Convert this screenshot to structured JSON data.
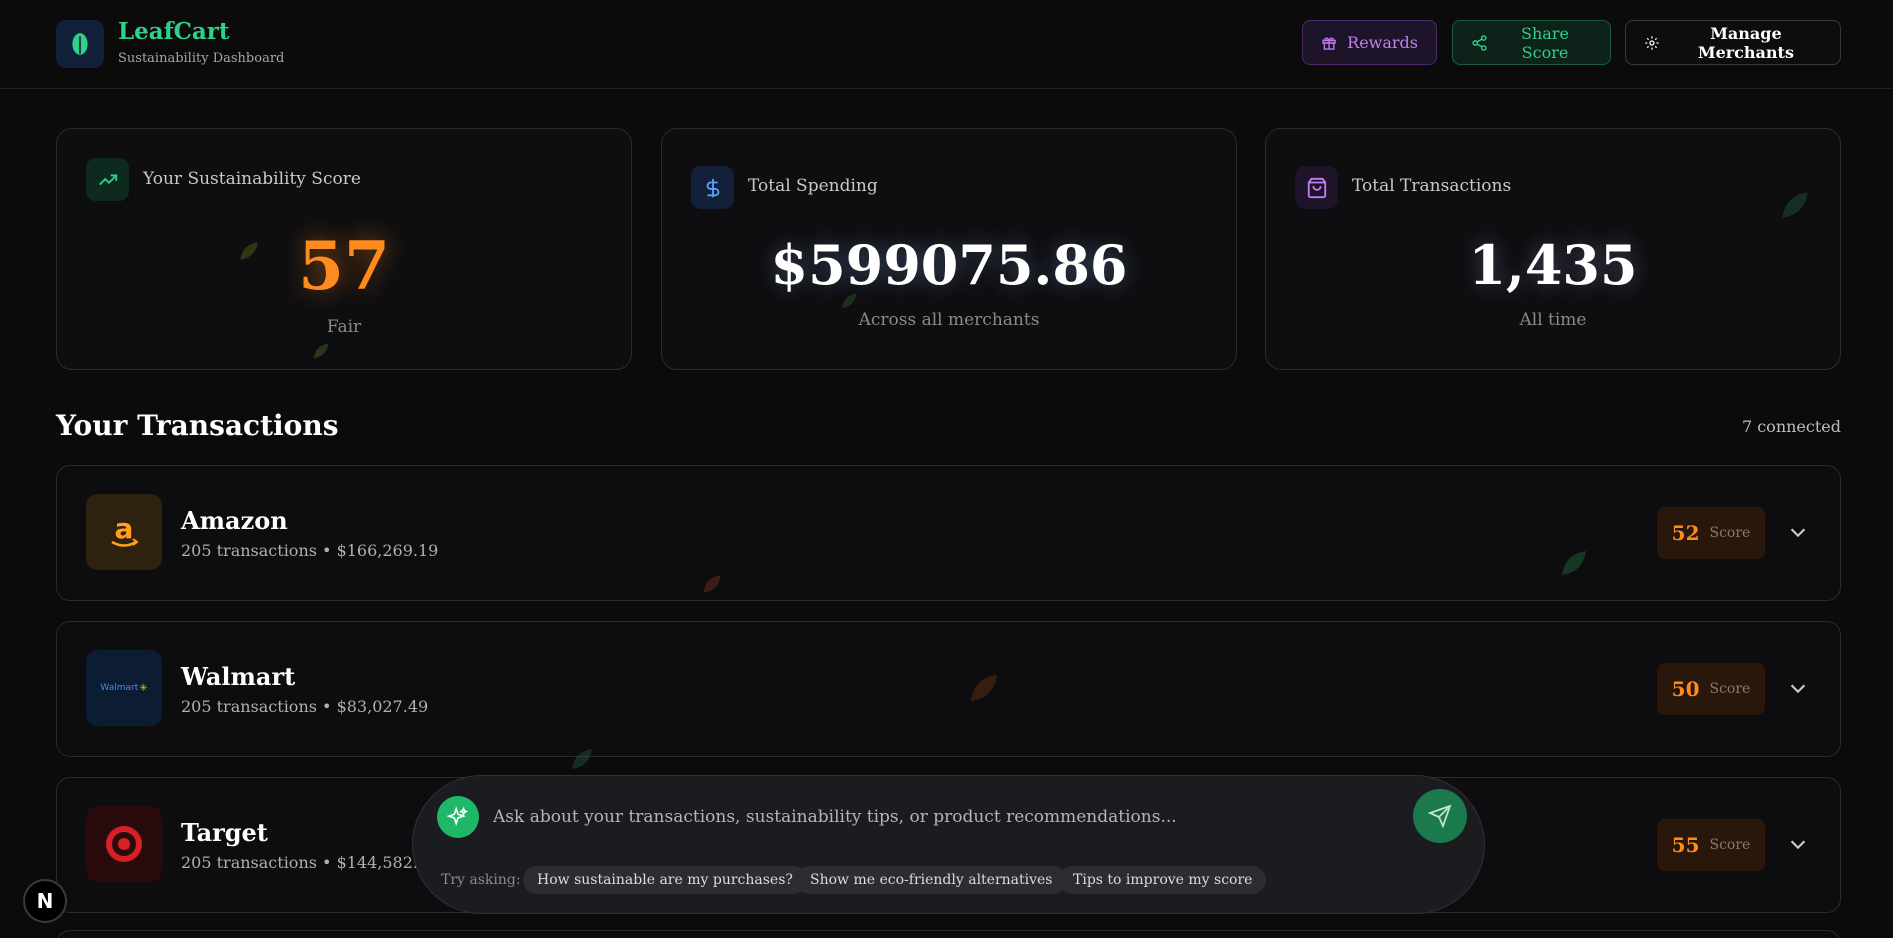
{
  "brand": {
    "title": "LeafCart",
    "subtitle": "Sustainability Dashboard",
    "icon": "leaf-icon"
  },
  "header_buttons": {
    "rewards": "Rewards",
    "share": "Share Score",
    "manage": "Manage Merchants"
  },
  "stats": {
    "score": {
      "label": "Your Sustainability Score",
      "value": "57",
      "rating": "Fair",
      "color": "#ff8a1e"
    },
    "spending": {
      "label": "Total Spending",
      "value": "$599075.86",
      "sub": "Across all merchants"
    },
    "transactions": {
      "label": "Total Transactions",
      "value": "1,435",
      "sub": "All time"
    }
  },
  "transactions": {
    "title": "Your Transactions",
    "connected": "7 connected",
    "score_word": "Score",
    "items": [
      {
        "name": "Amazon",
        "meta": "205 transactions • $166,269.19",
        "score": "52",
        "logo": "amazon-logo"
      },
      {
        "name": "Walmart",
        "meta": "205 transactions • $83,027.49",
        "score": "50",
        "logo": "walmart-logo",
        "logo_text": "Walmart"
      },
      {
        "name": "Target",
        "meta": "205 transactions • $144,582.14",
        "score": "55",
        "logo": "target-logo"
      }
    ]
  },
  "chat": {
    "placeholder": "Ask about your transactions, sustainability tips, or product recommendations...",
    "try_label": "Try asking:",
    "suggestions": [
      "How sustainable are my purchases?",
      "Show me eco-friendly alternatives",
      "Tips to improve my score"
    ]
  },
  "dev_badge": "N",
  "colors": {
    "accent": "#2fd08a",
    "score": "#ff8a1e",
    "purple": "#c37ef0"
  }
}
